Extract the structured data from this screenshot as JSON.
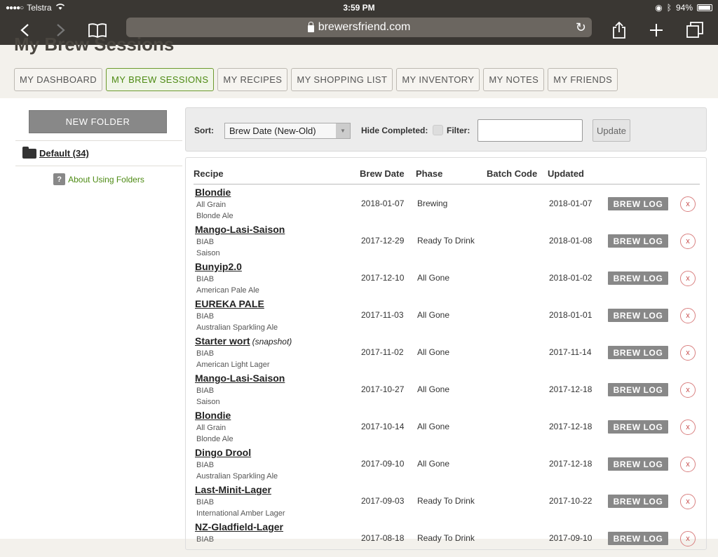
{
  "status": {
    "carrier": "Telstra",
    "time": "3:59 PM",
    "battery": "94%"
  },
  "browser": {
    "url": "brewersfriend.com"
  },
  "page": {
    "title": "My Brew Sessions"
  },
  "tabs": [
    "MY DASHBOARD",
    "MY BREW SESSIONS",
    "MY RECIPES",
    "MY SHOPPING LIST",
    "MY INVENTORY",
    "MY NOTES",
    "MY FRIENDS"
  ],
  "sidebar": {
    "new_folder": "NEW FOLDER",
    "folder": "Default (34)",
    "help_glyph": "?",
    "about": "About Using Folders"
  },
  "filters": {
    "sort_label": "Sort:",
    "sort_value": "Brew Date (New-Old)",
    "hide_completed_label": "Hide Completed:",
    "filter_label": "Filter:",
    "filter_value": "",
    "update_label": "Update"
  },
  "table": {
    "headers": {
      "recipe": "Recipe",
      "brew_date": "Brew Date",
      "phase": "Phase",
      "batch_code": "Batch Code",
      "updated": "Updated"
    },
    "brew_log_label": "BREW LOG",
    "delete_glyph": "x",
    "rows": [
      {
        "name": "Blondie",
        "tag": "",
        "type": "All Grain",
        "style": "Blonde Ale",
        "brew_date": "2018-01-07",
        "phase": "Brewing",
        "batch_code": "",
        "updated": "2018-01-07"
      },
      {
        "name": "Mango-Lasi-Saison",
        "tag": "",
        "type": "BIAB",
        "style": "Saison",
        "brew_date": "2017-12-29",
        "phase": "Ready To Drink",
        "batch_code": "",
        "updated": "2018-01-08"
      },
      {
        "name": "Bunyip2.0",
        "tag": "",
        "type": "BIAB",
        "style": "American Pale Ale",
        "brew_date": "2017-12-10",
        "phase": "All Gone",
        "batch_code": "",
        "updated": "2018-01-02"
      },
      {
        "name": "EUREKA PALE",
        "tag": "",
        "type": "BIAB",
        "style": "Australian Sparkling Ale",
        "brew_date": "2017-11-03",
        "phase": "All Gone",
        "batch_code": "",
        "updated": "2018-01-01"
      },
      {
        "name": "Starter wort",
        "tag": "(snapshot)",
        "type": "BIAB",
        "style": "American Light Lager",
        "brew_date": "2017-11-02",
        "phase": "All Gone",
        "batch_code": "",
        "updated": "2017-11-14"
      },
      {
        "name": "Mango-Lasi-Saison",
        "tag": "",
        "type": "BIAB",
        "style": "Saison",
        "brew_date": "2017-10-27",
        "phase": "All Gone",
        "batch_code": "",
        "updated": "2017-12-18"
      },
      {
        "name": "Blondie",
        "tag": "",
        "type": "All Grain",
        "style": "Blonde Ale",
        "brew_date": "2017-10-14",
        "phase": "All Gone",
        "batch_code": "",
        "updated": "2017-12-18"
      },
      {
        "name": "Dingo Drool",
        "tag": "",
        "type": "BIAB",
        "style": "Australian Sparkling Ale",
        "brew_date": "2017-09-10",
        "phase": "All Gone",
        "batch_code": "",
        "updated": "2017-12-18"
      },
      {
        "name": "Last-Minit-Lager",
        "tag": "",
        "type": "BIAB",
        "style": "International Amber Lager",
        "brew_date": "2017-09-03",
        "phase": "Ready To Drink",
        "batch_code": "",
        "updated": "2017-10-22"
      },
      {
        "name": "NZ-Gladfield-Lager",
        "tag": "",
        "type": "BIAB",
        "style": "",
        "brew_date": "2017-08-18",
        "phase": "Ready To Drink",
        "batch_code": "",
        "updated": "2017-09-10"
      }
    ]
  },
  "colors": {
    "accent": "#4d8a13",
    "header_bg": "#3a3733",
    "button_gray": "#888888",
    "delete_red": "#c85050"
  }
}
